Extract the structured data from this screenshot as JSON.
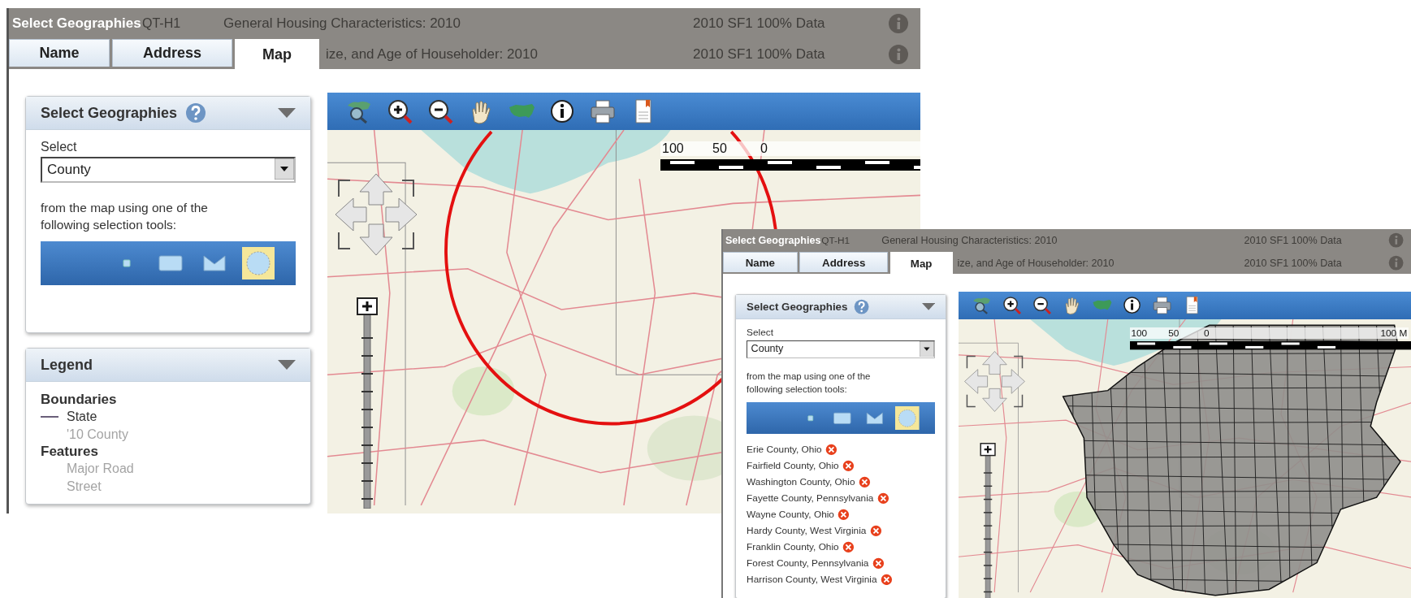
{
  "windows": [
    {
      "title": "Select Geographies",
      "background_rows": [
        {
          "code": "QT-H1",
          "description": "General Housing Characteristics: 2010",
          "dataset": "2010 SF1 100% Data"
        },
        {
          "description": "ize, and Age of Householder: 2010",
          "dataset": "2010 SF1 100% Data"
        }
      ],
      "tabs": [
        {
          "label": "Name",
          "selected": false
        },
        {
          "label": "Address",
          "selected": false
        },
        {
          "label": "Map",
          "selected": true
        }
      ],
      "select_panel": {
        "title": "Select Geographies",
        "select_label": "Select",
        "select_value": "County",
        "instructions": "from the map using one of the following selection tools:",
        "tools": [
          {
            "kind": "point",
            "selected": false
          },
          {
            "kind": "rectangle",
            "selected": false
          },
          {
            "kind": "polygon",
            "selected": false
          },
          {
            "kind": "circle",
            "selected": true
          }
        ]
      },
      "legend": {
        "title": "Legend",
        "groups": [
          {
            "heading": "Boundaries",
            "items": [
              {
                "label": "State",
                "kind": "line",
                "dimmed": false
              },
              {
                "label": "'10 County",
                "kind": "none",
                "dimmed": true
              }
            ]
          },
          {
            "heading": "Features",
            "items": [
              {
                "label": "Major Road",
                "kind": "none",
                "dimmed": true
              },
              {
                "label": "Street",
                "kind": "none",
                "dimmed": true
              }
            ]
          }
        ]
      },
      "map": {
        "kind": "circle-selection",
        "scale_labels": [
          "100",
          "50",
          "0"
        ]
      }
    },
    {
      "title": "Select Geographies",
      "background_rows": [
        {
          "code": "QT-H1",
          "description": "General Housing Characteristics: 2010",
          "dataset": "2010 SF1 100% Data"
        },
        {
          "description": "ize, and Age of Householder: 2010",
          "dataset": "2010 SF1 100% Data"
        }
      ],
      "tabs": [
        {
          "label": "Name",
          "selected": false
        },
        {
          "label": "Address",
          "selected": false
        },
        {
          "label": "Map",
          "selected": true
        }
      ],
      "select_panel": {
        "title": "Select Geographies",
        "select_label": "Select",
        "select_value": "County",
        "instructions": "from the map using one of the following selection tools:",
        "tools": [
          {
            "kind": "point",
            "selected": false
          },
          {
            "kind": "rectangle",
            "selected": false
          },
          {
            "kind": "polygon",
            "selected": false
          },
          {
            "kind": "circle",
            "selected": true
          }
        ],
        "selections": [
          "Erie County, Ohio",
          "Fairfield County, Ohio",
          "Washington County, Ohio",
          "Fayette County, Pennsylvania",
          "Wayne County, Ohio",
          "Hardy County, West Virginia",
          "Franklin County, Ohio",
          "Forest County, Pennsylvania",
          "Harrison County, West Virginia"
        ]
      },
      "map": {
        "kind": "county-selection",
        "scale_labels": [
          "100",
          "50",
          "0",
          "100 M"
        ]
      }
    }
  ]
}
